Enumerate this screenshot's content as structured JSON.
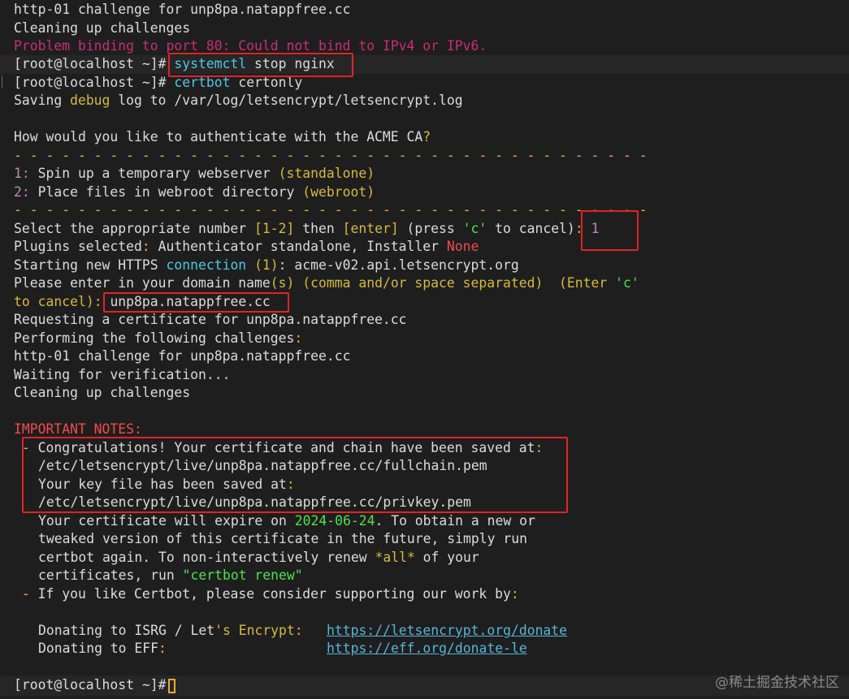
{
  "terminal": {
    "prompt": "[root@localhost ~]#",
    "lines": {
      "l1": "http-01 challenge for unp8pa.natappfree.cc",
      "l2": "Cleaning up challenges",
      "l3": "Problem binding to port 80: Could not bind to IPv4 or IPv6.",
      "l4_cmd1": "systemctl",
      "l4_cmd2": " stop nginx",
      "l5_cmd1": "certbot",
      "l5_cmd2": " certonly",
      "l6a": "Saving ",
      "l6b": "debug",
      "l6c": " log to /var/log/letsencrypt/letsencrypt.log",
      "l8a": "How would you like to authenticate with the ACME CA",
      "l8b": "?",
      "sep": "- - - - - - - - - - - - - - - - - - - - - - - - - - - - - - - - - - - - - - - -",
      "opt1_num": "1:",
      "opt1_text": " Spin up a temporary webserver ",
      "opt1_paren": "(standalone)",
      "opt2_num": "2:",
      "opt2_text": " Place files in webroot directory ",
      "opt2_paren": "(webroot)",
      "sel_a": "Select the appropriate number ",
      "sel_b": "[1-2]",
      "sel_c": " then ",
      "sel_d": "[enter]",
      "sel_e": " (press ",
      "sel_f": "'c'",
      "sel_g": " to cancel)",
      "sel_h": ":",
      "sel_val": "1",
      "plug_a": "Plugins selected",
      "plug_b": ":",
      "plug_c": " Authenticator standalone, Installer ",
      "plug_d": "None",
      "start_a": "Starting new HTTPS ",
      "start_b": "connection",
      "start_c": " ",
      "start_d": "(1)",
      "start_e": ": acme-v02.api.letsencrypt.org",
      "dom_a": "Please enter in your domain name",
      "dom_b": "(s)",
      "dom_c": " ",
      "dom_d": "(comma and/or space separated)",
      "dom_e": "  (Enter ",
      "dom_f": "'c'",
      "cancel_a": "to cancel",
      "cancel_b": ")",
      "cancel_c": ":",
      "domain_val": "unp8pa.natappfree.cc",
      "req": "Requesting a certificate for unp8pa.natappfree.cc",
      "perf_a": "Performing the following challenges",
      "perf_b": ":",
      "http01": "http-01 challenge for unp8pa.natappfree.cc",
      "wait": "Waiting for verification...",
      "clean": "Cleaning up challenges",
      "notes": "IMPORTANT NOTES:",
      "dash": " -",
      "congrats_a": "Congratulations! Your certificate and chain have been saved at",
      "congrats_b": ":",
      "fullchain": "/etc/letsencrypt/live/unp8pa.natappfree.cc/fullchain.pem",
      "key_a": "Your key file has been saved at",
      "key_b": ":",
      "privkey": "/etc/letsencrypt/live/unp8pa.natappfree.cc/privkey.pem",
      "exp_a": "Your certificate will expire on ",
      "exp_date": "2024-06-24",
      "exp_b": ". To obtain a new or",
      "tweak": "tweaked version of this certificate in the future, simply run",
      "again_a": "certbot again. To non-interactively renew ",
      "again_b": "*all*",
      "again_c": " of your",
      "certs_a": "certificates, run ",
      "certs_b": "\"certbot renew\"",
      "like_a": "If you like Certbot, please consider supporting our work by",
      "like_b": ":",
      "don1_a": "Donating to ISRG / Let",
      "don1_b": "'s Encrypt:",
      "don1_link": "https://letsencrypt.org/donate",
      "don2_a": "Donating to EFF",
      "don2_b": ":",
      "don2_link": "https://eff.org/donate-le"
    }
  },
  "watermark": "@稀土掘金技术社区",
  "colors": {
    "background": "#1e1e1e",
    "error": "#c9306f",
    "command": "#4ec9e6",
    "highlight_box": "#e02424"
  }
}
